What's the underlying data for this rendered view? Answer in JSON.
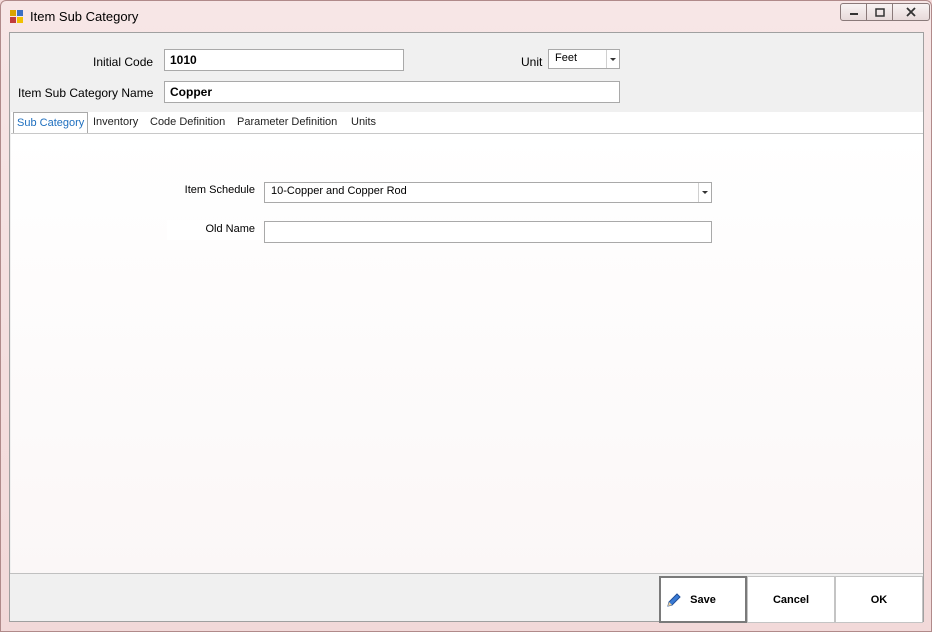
{
  "window": {
    "title": "Item Sub Category"
  },
  "form": {
    "initial_code_label": "Initial Code",
    "initial_code_value": "1010",
    "unit_label": "Unit",
    "unit_value": "Feet",
    "name_label": "Item Sub Category Name",
    "name_value": "Copper"
  },
  "tabs": [
    {
      "label": "Sub Category",
      "active": true
    },
    {
      "label": "Inventory"
    },
    {
      "label": "Code Definition"
    },
    {
      "label": "Parameter Definition"
    },
    {
      "label": "Units"
    }
  ],
  "sub_category": {
    "item_schedule_label": "Item Schedule",
    "item_schedule_value": "10-Copper and Copper Rod",
    "old_name_label": "Old Name",
    "old_name_value": ""
  },
  "buttons": {
    "save": "Save",
    "cancel": "Cancel",
    "ok": "OK"
  },
  "colors": {
    "active_tab_text": "#1e6fbf",
    "window_frame": "#f2d9d9"
  }
}
